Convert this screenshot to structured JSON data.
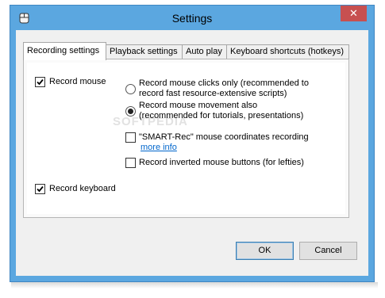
{
  "window": {
    "title": "Settings",
    "close_symbol": "✕",
    "accent": "#5ba7e0",
    "close_color": "#c75050"
  },
  "tabs": [
    {
      "label": "Recording settings",
      "active": true
    },
    {
      "label": "Playback settings",
      "active": false
    },
    {
      "label": "Auto play",
      "active": false
    },
    {
      "label": "Keyboard shortcuts (hotkeys)",
      "active": false
    }
  ],
  "recording": {
    "record_mouse": {
      "label": "Record mouse",
      "checked": true
    },
    "clicks_only": {
      "line1": "Record mouse clicks only (recommended to",
      "line2": "record fast resource-extensive scripts)",
      "selected": false
    },
    "movement": {
      "line1": "Record mouse movement also",
      "line2": "(recommended for tutorials, presentations)",
      "selected": true
    },
    "smart_rec": {
      "label": "\"SMART-Rec\" mouse coordinates recording",
      "checked": false,
      "more_info": "more info"
    },
    "inverted": {
      "label": "Record inverted mouse buttons (for lefties)",
      "checked": false
    },
    "record_keyboard": {
      "label": "Record keyboard",
      "checked": true
    }
  },
  "watermark": "SOFTPEDIA",
  "buttons": {
    "ok": "OK",
    "cancel": "Cancel"
  }
}
